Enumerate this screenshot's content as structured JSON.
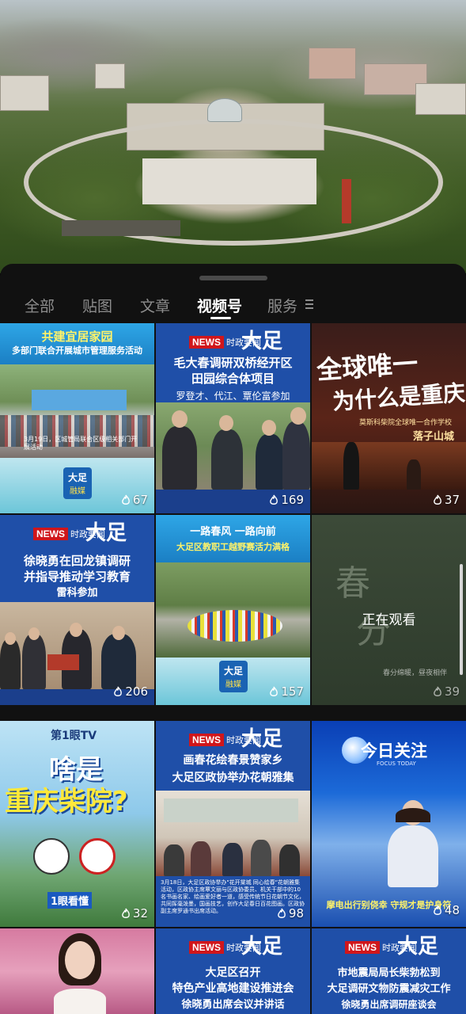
{
  "tabs": [
    {
      "label": "全部",
      "active": false
    },
    {
      "label": "贴图",
      "active": false
    },
    {
      "label": "文章",
      "active": false
    },
    {
      "label": "视频号",
      "active": true
    },
    {
      "label": "服务",
      "active": false
    }
  ],
  "more_icon": "menu-lines-icon",
  "videos": [
    {
      "id": "v1",
      "title_line1": "共建宜居家园",
      "title_line2": "多部门联合开展城市管理服务活动",
      "caption": "3月19日，区城管局联合区级相关部门开展活动",
      "brand": "大足",
      "brand_sub": "融媒",
      "count": "67"
    },
    {
      "id": "v2",
      "news_badge": "NEWS",
      "news_sub": "时政要闻",
      "news_big": "大足",
      "headline": [
        "毛大春调研双桥经开区",
        "田园综合体项目",
        "罗登才、代江、覃伦富参加"
      ],
      "count": "169"
    },
    {
      "id": "v3",
      "title_line1": "全球唯一",
      "title_line2": "为什么是重庆",
      "subtitle": "莫斯科柴院全球唯一合作学校",
      "location": "落子山城",
      "count": "37"
    },
    {
      "id": "v4",
      "news_badge": "NEWS",
      "news_sub": "时政要闻",
      "news_big": "大足",
      "headline": [
        "徐晓勇在回龙镇调研",
        "并指导推动学习教育",
        "雷科参加"
      ],
      "count": "206"
    },
    {
      "id": "v5",
      "title_line1": "一路春风 一路向前",
      "title_line2": "大足区教职工越野赛活力满格",
      "brand": "大足",
      "brand_sub": "融媒",
      "count": "157"
    },
    {
      "id": "v6",
      "title_line1": "春",
      "title_line2": "分",
      "watching": "正在观看",
      "caption": "春分绵暖，昼夜相伴",
      "count": "39"
    },
    {
      "id": "v7",
      "channel": "第1眼TV",
      "title_line1": "啥是",
      "title_line2": "重庆柴院?",
      "footer": "1眼看懂",
      "count": "32"
    },
    {
      "id": "v8",
      "news_badge": "NEWS",
      "news_sub": "时政要闻",
      "news_big": "大足",
      "headline": [
        "画春花绘春景赞家乡",
        "大足区政协举办花朝雅集"
      ],
      "caption": "3月18日，大足区政协举办\"花开棠城 同心绘春\"花朝雅集活动，区政协主席覃文丽与区政协委员、机关干部中的10名书画名家、绘画爱好者一道，感受传统节日花朝节文化，共同挥毫泼墨，国画技艺，创作大足春日百花图画。区政协副主席罗通书出席活动。",
      "count": "98"
    },
    {
      "id": "v9",
      "title": "今日关注",
      "title_en": "FOCUS TODAY",
      "subtitle": "摩电出行别侥幸 守规才是护身符",
      "count": "48"
    },
    {
      "id": "v10",
      "count": ""
    },
    {
      "id": "v11",
      "news_badge": "NEWS",
      "news_sub": "时政要闻",
      "news_big": "大足",
      "headline": [
        "大足区召开",
        "特色产业高地建设推进会",
        "徐晓勇出席会议并讲话"
      ]
    },
    {
      "id": "v12",
      "news_badge": "NEWS",
      "news_sub": "时政要闻",
      "news_big": "大足",
      "headline": [
        "市地震局局长柴勃松到",
        "大足调研文物防震减灾工作",
        "徐晓勇出席调研座谈会"
      ]
    }
  ]
}
